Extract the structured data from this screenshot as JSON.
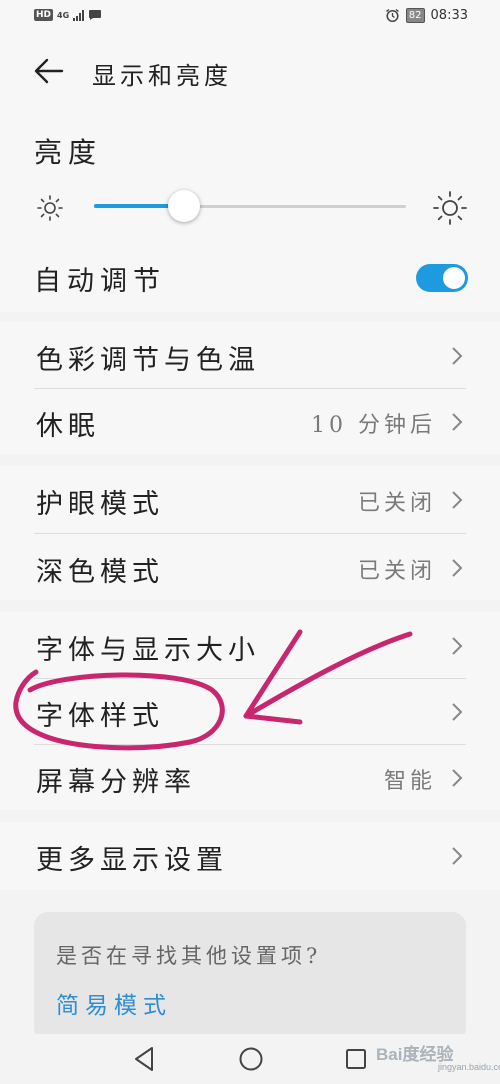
{
  "status_bar": {
    "left_badge": "HD",
    "network": "4G",
    "battery": "82",
    "time": "08:33"
  },
  "header": {
    "title": "显示和亮度"
  },
  "brightness": {
    "label": "亮度",
    "level": 0.29,
    "auto_label": "自动调节",
    "auto_enabled": true
  },
  "groups": [
    {
      "items": [
        {
          "label": "色彩调节与色温",
          "value": ""
        },
        {
          "label": "休眠",
          "value": "10 分钟后"
        }
      ]
    },
    {
      "items": [
        {
          "label": "护眼模式",
          "value": "已关闭"
        },
        {
          "label": "深色模式",
          "value": "已关闭"
        }
      ]
    },
    {
      "items": [
        {
          "label": "字体与显示大小",
          "value": ""
        },
        {
          "label": "字体样式",
          "value": ""
        },
        {
          "label": "屏幕分辨率",
          "value": "智能"
        }
      ]
    },
    {
      "items": [
        {
          "label": "更多显示设置",
          "value": ""
        }
      ]
    }
  ],
  "suggestion": {
    "question": "是否在寻找其他设置项?",
    "link": "简易模式"
  },
  "watermark": {
    "brand": "Bai度经验",
    "url": "jingyan.baidu.com"
  },
  "colors": {
    "accent": "#1e9be0",
    "annotation": "#c8266f"
  }
}
